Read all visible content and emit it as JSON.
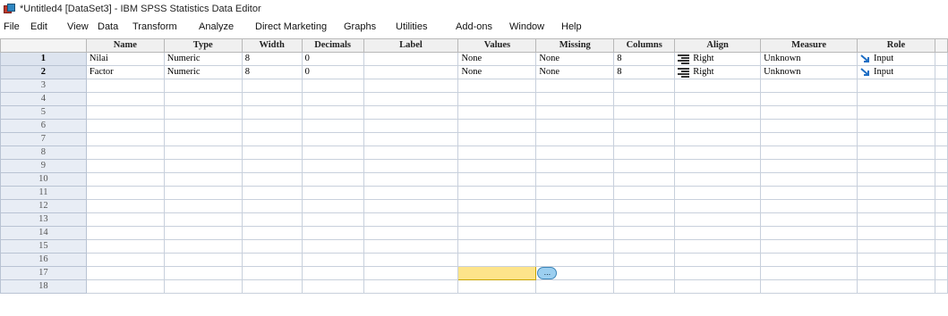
{
  "window": {
    "title": "*Untitled4 [DataSet3] - IBM SPSS Statistics Data Editor"
  },
  "menu": [
    "File",
    "Edit",
    "View",
    "Data",
    "Transform",
    "Analyze",
    "Direct Marketing",
    "Graphs",
    "Utilities",
    "Add-ons",
    "Window",
    "Help"
  ],
  "columns": [
    "Name",
    "Type",
    "Width",
    "Decimals",
    "Label",
    "Values",
    "Missing",
    "Columns",
    "Align",
    "Measure",
    "Role"
  ],
  "rows": [
    {
      "num": "1",
      "name": "Nilai",
      "type": "Numeric",
      "width": "8",
      "decimals": "0",
      "label": "",
      "values": "None",
      "missing": "None",
      "columns": "8",
      "align": "Right",
      "measure": "Unknown",
      "role": "Input"
    },
    {
      "num": "2",
      "name": "Factor",
      "type": "Numeric",
      "width": "8",
      "decimals": "0",
      "label": "",
      "values": "None",
      "missing": "None",
      "columns": "8",
      "align": "Right",
      "measure": "Unknown",
      "role": "Input"
    }
  ],
  "empty_rows": [
    "3",
    "4",
    "5",
    "6",
    "7",
    "8",
    "9",
    "10",
    "11",
    "12",
    "13",
    "14",
    "15",
    "16",
    "17",
    "18"
  ],
  "editing_row": "17",
  "editing_column": "Values",
  "dots_button_label": "...",
  "colors": {
    "role_icon": "#1f6fc5",
    "edit_cell": "#fde48a",
    "dots_button": "#9ccff0"
  },
  "icons": {
    "align": "align-right-icon",
    "role": "input-arrow-icon",
    "app": "spss-app-icon"
  }
}
